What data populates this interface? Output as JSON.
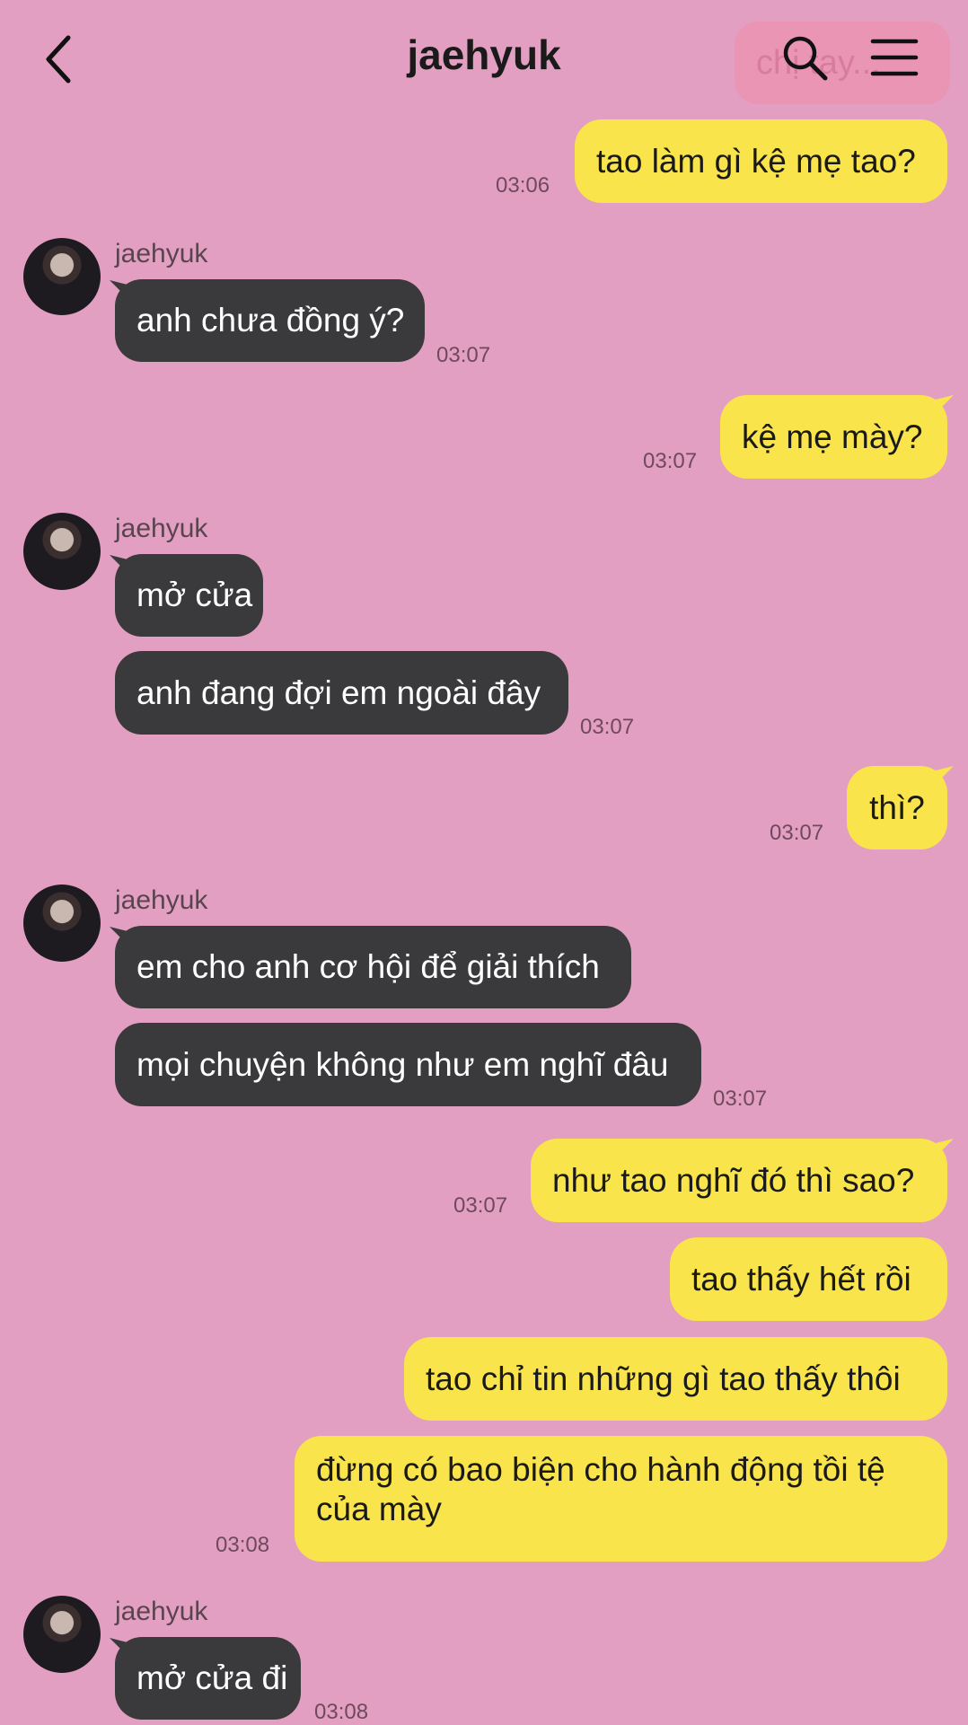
{
  "header": {
    "title": "jaehyuk",
    "ghost_text": "chị tay..."
  },
  "messages": [
    {
      "side": "me",
      "text": "tao làm gì kệ mẹ tao?",
      "time": "03:06"
    },
    {
      "side": "them",
      "sender": "jaehyuk",
      "text": "anh chưa đồng ý?",
      "time": "03:07"
    },
    {
      "side": "me",
      "text": "kệ mẹ mày?",
      "time": "03:07"
    },
    {
      "side": "them",
      "sender": "jaehyuk",
      "text": "mở cửa"
    },
    {
      "side": "them",
      "text": "anh đang đợi em ngoài đây",
      "time": "03:07"
    },
    {
      "side": "me",
      "text": "thì?",
      "time": "03:07"
    },
    {
      "side": "them",
      "sender": "jaehyuk",
      "text": "em cho anh cơ hội để giải thích"
    },
    {
      "side": "them",
      "text": "mọi chuyện không như em nghĩ đâu",
      "time": "03:07"
    },
    {
      "side": "me",
      "text": "như tao nghĩ đó thì sao?",
      "time": "03:07"
    },
    {
      "side": "me",
      "text": "tao thấy hết rồi"
    },
    {
      "side": "me",
      "text": "tao chỉ tin những gì tao thấy thôi"
    },
    {
      "side": "me",
      "text": "đừng có bao biện cho hành động tồi tệ của mày",
      "time": "03:08"
    },
    {
      "side": "them",
      "sender": "jaehyuk",
      "text": "mở cửa đi",
      "time": "03:08"
    }
  ],
  "colors": {
    "background": "#e39fc1",
    "me_bubble": "#f9e44b",
    "them_bubble": "#3a3a3c"
  },
  "icons": [
    "back-icon",
    "search-icon",
    "menu-icon",
    "avatar"
  ]
}
